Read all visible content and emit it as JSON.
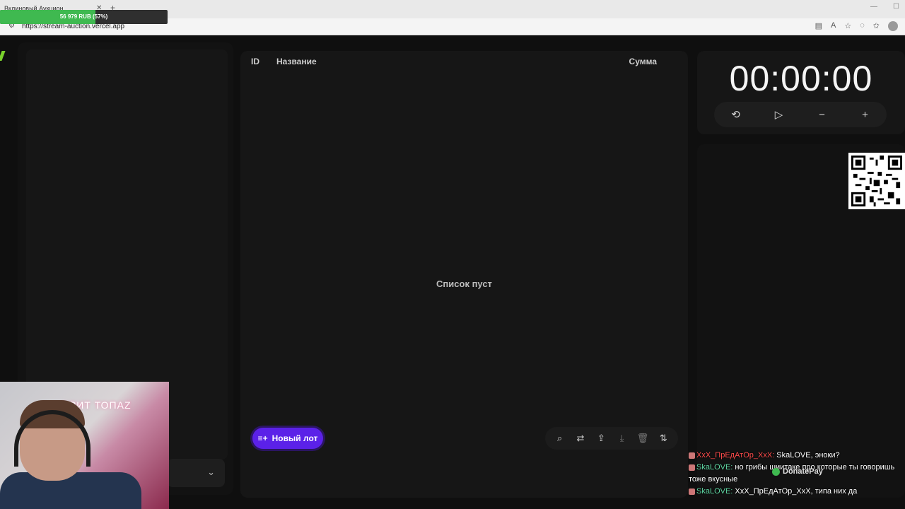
{
  "browser": {
    "tab_title": "Вклиновый Аукцион",
    "url": "https://stream-auction.vercel.app"
  },
  "donation": {
    "text": "56 979 RUB (57%)",
    "progress": 0.57
  },
  "table": {
    "col_id": "ID",
    "col_name": "Название",
    "col_sum": "Сумма",
    "empty_text": "Список пуст"
  },
  "actions": {
    "new_lot": "Новый лот"
  },
  "timer": {
    "display": "00:00:00"
  },
  "chat": [
    {
      "user": "XxX_ПрЕдАтОр_XxX:",
      "text": " SkaLOVE, эноки?"
    },
    {
      "user": "SkaLOVE:",
      "text": " но грибы шиитаке про которые ты говоришь тоже вкусные"
    },
    {
      "user": "SkaLOVE:",
      "text": " XxX_ПрЕдАтОр_XxX, типа них да"
    }
  ],
  "overlay": {
    "donatepay": "DonatePay",
    "cam_sign": "ОРИТ ТОПАZ"
  },
  "colors": {
    "accent": "#5b21e8",
    "progress": "#3fb950"
  }
}
